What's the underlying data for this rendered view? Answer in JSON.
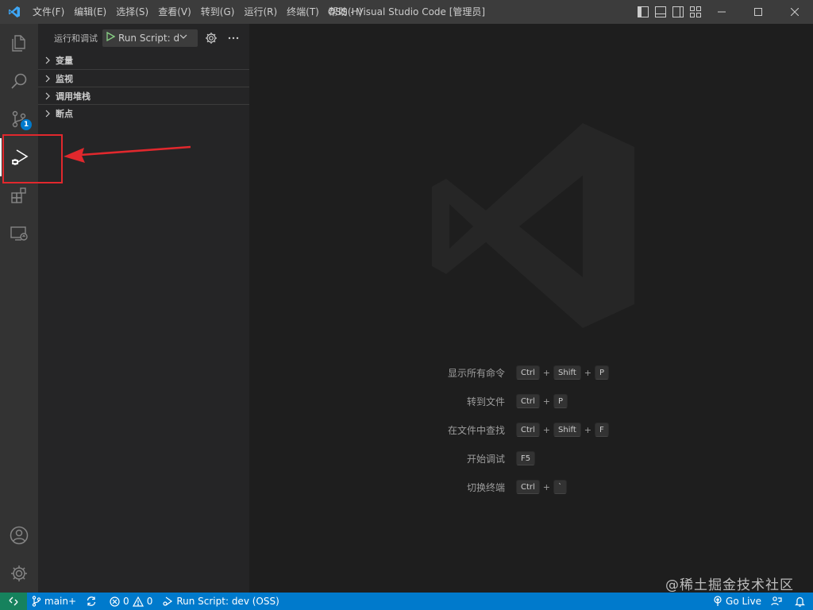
{
  "titlebar": {
    "menu": [
      "文件(F)",
      "编辑(E)",
      "选择(S)",
      "查看(V)",
      "转到(G)",
      "运行(R)",
      "终端(T)",
      "帮助(H)"
    ],
    "window_title": "OSS - Visual Studio Code [管理员]"
  },
  "activitybar": {
    "items": [
      "explorer-icon",
      "search-icon",
      "source-control-icon",
      "run-debug-icon",
      "extensions-icon",
      "remote-explorer-icon"
    ],
    "bottom_items": [
      "account-icon",
      "manage-gear-icon"
    ],
    "source_control_badge": "1",
    "active_item": "run-debug-icon"
  },
  "sidebar": {
    "title": "运行和调试",
    "run_config": "Run Script: d",
    "sections": [
      "变量",
      "监视",
      "调用堆栈",
      "断点"
    ]
  },
  "editor": {
    "shortcuts": [
      {
        "label": "显示所有命令",
        "keys": [
          "Ctrl",
          "Shift",
          "P"
        ]
      },
      {
        "label": "转到文件",
        "keys": [
          "Ctrl",
          "P"
        ]
      },
      {
        "label": "在文件中查找",
        "keys": [
          "Ctrl",
          "Shift",
          "F"
        ]
      },
      {
        "label": "开始调试",
        "keys": [
          "F5"
        ]
      },
      {
        "label": "切换终端",
        "keys": [
          "Ctrl",
          "`"
        ]
      }
    ]
  },
  "statusbar": {
    "branch": "main+",
    "errors": "0",
    "warnings": "0",
    "debug_config": "Run Script: dev (OSS)",
    "go_live": "Go Live"
  },
  "watermark": "@稀土掘金技术社区",
  "colors": {
    "accent": "#007acc",
    "remote": "#16825d",
    "annotation": "#e1282d"
  }
}
